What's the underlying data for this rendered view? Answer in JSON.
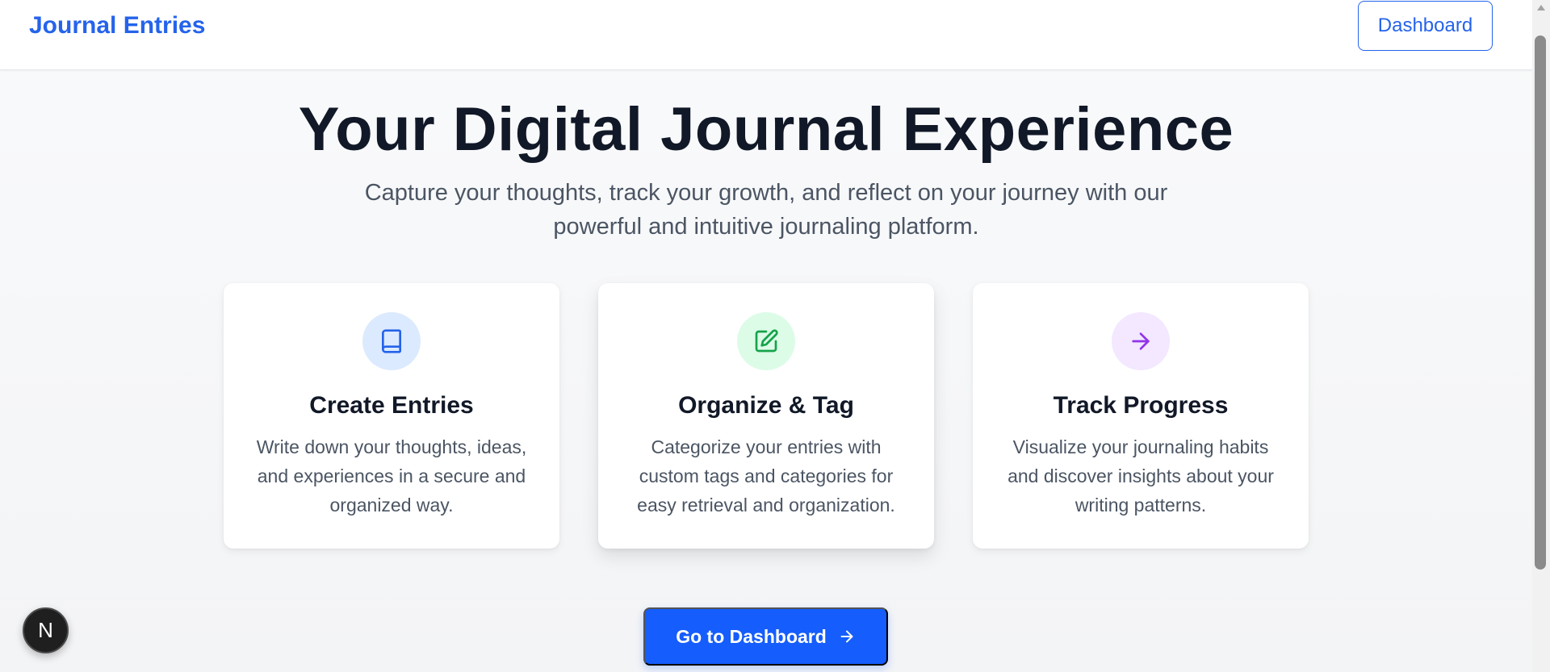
{
  "header": {
    "brand": "Journal Entries",
    "dashboard_button": "Dashboard"
  },
  "hero": {
    "title": "Your Digital Journal Experience",
    "subtitle": "Capture your thoughts, track your growth, and reflect on your journey with our powerful and intuitive journaling platform."
  },
  "features": [
    {
      "icon": "book-icon",
      "title": "Create Entries",
      "description": "Write down your thoughts, ideas, and experiences in a secure and organized way.",
      "icon_color": "#2563eb",
      "icon_bg": "#dbeafe"
    },
    {
      "icon": "edit-icon",
      "title": "Organize & Tag",
      "description": "Categorize your entries with custom tags and categories for easy retrieval and organization.",
      "icon_color": "#16a34a",
      "icon_bg": "#dcfce7"
    },
    {
      "icon": "arrow-right-icon",
      "title": "Track Progress",
      "description": "Visualize your journaling habits and discover insights about your writing patterns.",
      "icon_color": "#9333ea",
      "icon_bg": "#f3e8ff"
    }
  ],
  "cta": {
    "label": "Go to Dashboard",
    "icon": "arrow-right-icon"
  },
  "dev_badge": {
    "letter": "N"
  },
  "colors": {
    "primary": "#155dfc",
    "brand": "#2563eb",
    "heading": "#111827",
    "body_text": "#4b5563"
  }
}
